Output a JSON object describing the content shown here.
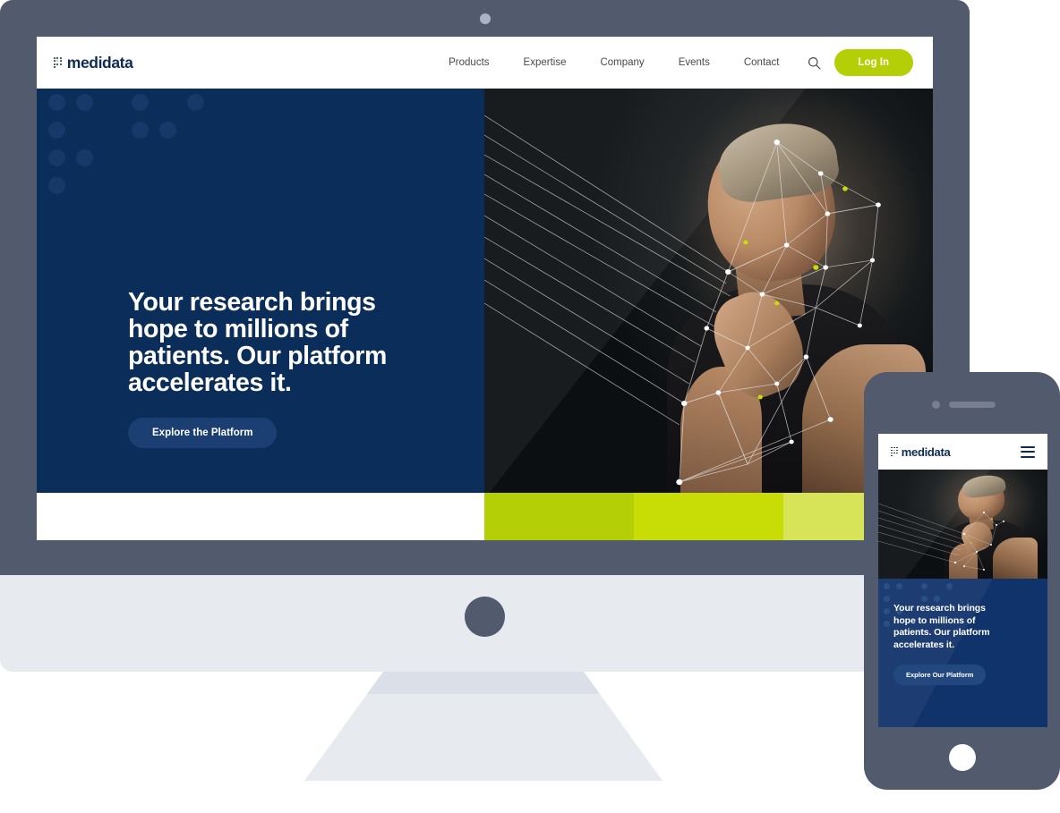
{
  "device_mockup": {
    "monitor": {
      "camera_icon": "camera-dot",
      "logo_button_icon": "brand-circle"
    },
    "phone": {
      "camera_icon": "camera-dot",
      "speaker_icon": "speaker-slot",
      "home_button_icon": "home-button"
    }
  },
  "desktop": {
    "header": {
      "brand": "medidata",
      "logo_icon": "medidata-dot-grid-logo",
      "nav": [
        {
          "label": "Products"
        },
        {
          "label": "Expertise"
        },
        {
          "label": "Company"
        },
        {
          "label": "Events"
        },
        {
          "label": "Contact"
        }
      ],
      "search_icon": "search-icon",
      "login_label": "Log In"
    },
    "hero": {
      "title": "Your research brings\nhope to millions of\npatients. Our platform\naccelerates it.",
      "cta_label": "Explore the Platform",
      "image_alt": "smiling-person-with-network-overlay",
      "network_overlay_icon": "node-network-graphic"
    },
    "color_bars": [
      {
        "name": "bar-one",
        "color": "#b5cf07"
      },
      {
        "name": "bar-two",
        "color": "#c8dc05"
      },
      {
        "name": "bar-three",
        "color": "#d8e457"
      }
    ]
  },
  "mobile": {
    "header": {
      "brand": "medidata",
      "logo_icon": "medidata-dot-grid-logo",
      "menu_icon": "hamburger-menu-icon"
    },
    "hero": {
      "title": "Your research brings\nhope to millions of\npatients. Our platform\naccelerates it.",
      "cta_label": "Explore Our Platform",
      "image_alt": "smiling-person-with-network-overlay"
    }
  },
  "colors": {
    "brand_navy": "#0b2d59",
    "brand_green": "#b5cf07",
    "device_gray": "#525a6e",
    "chin_gray": "#e7eaee"
  }
}
